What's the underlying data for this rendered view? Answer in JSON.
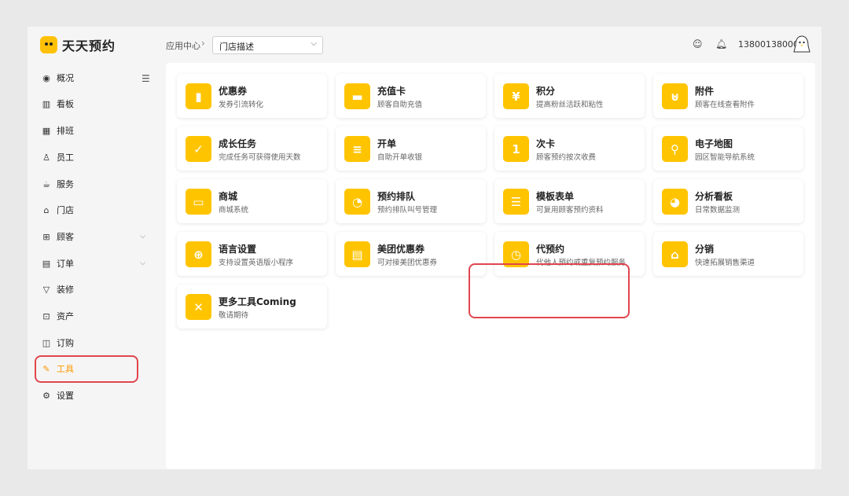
{
  "brand": {
    "name": "天天预约"
  },
  "header": {
    "breadcrumb": "应用中心",
    "separator": "›",
    "store_select": {
      "value": "门店描述"
    },
    "phone": "13800138000"
  },
  "sidebar": {
    "items": [
      {
        "label": "概况",
        "icon": "dashboard-icon",
        "glyph": "◉"
      },
      {
        "label": "看板",
        "icon": "bar-chart-icon",
        "glyph": "▥"
      },
      {
        "label": "排班",
        "icon": "calendar-icon",
        "glyph": "▦"
      },
      {
        "label": "员工",
        "icon": "user-icon",
        "glyph": "♙"
      },
      {
        "label": "服务",
        "icon": "cup-icon",
        "glyph": "☕"
      },
      {
        "label": "门店",
        "icon": "store-icon",
        "glyph": "⌂"
      },
      {
        "label": "顾客",
        "icon": "customers-icon",
        "glyph": "⊞"
      },
      {
        "label": "订单",
        "icon": "order-icon",
        "glyph": "▤"
      },
      {
        "label": "装修",
        "icon": "shirt-icon",
        "glyph": "▽"
      },
      {
        "label": "资产",
        "icon": "asset-icon",
        "glyph": "⊡"
      },
      {
        "label": "订购",
        "icon": "bag-icon",
        "glyph": "◫"
      },
      {
        "label": "工具",
        "icon": "tool-icon",
        "glyph": "✎",
        "active": true
      },
      {
        "label": "设置",
        "icon": "gear-icon",
        "glyph": "⚙"
      }
    ]
  },
  "tools": [
    {
      "name": "优惠券",
      "desc": "发券引流转化",
      "icon": "coupon-icon",
      "glyph": "▮"
    },
    {
      "name": "充值卡",
      "desc": "顾客自助充值",
      "icon": "card-icon",
      "glyph": "▬"
    },
    {
      "name": "积分",
      "desc": "提高粉丝活跃和粘性",
      "icon": "points-icon",
      "glyph": "¥"
    },
    {
      "name": "附件",
      "desc": "顾客在线查看附件",
      "icon": "attachment-icon",
      "glyph": "⊍"
    },
    {
      "name": "成长任务",
      "desc": "完成任务可获得使用天数",
      "icon": "task-icon",
      "glyph": "✓"
    },
    {
      "name": "开单",
      "desc": "自助开单收银",
      "icon": "invoice-icon",
      "glyph": "≡"
    },
    {
      "name": "次卡",
      "desc": "顾客预约按次收费",
      "icon": "count-card-icon",
      "glyph": "1"
    },
    {
      "name": "电子地图",
      "desc": "园区智能导航系统",
      "icon": "map-icon",
      "glyph": "⚲"
    },
    {
      "name": "商城",
      "desc": "商城系统",
      "icon": "mall-icon",
      "glyph": "▭"
    },
    {
      "name": "预约排队",
      "desc": "预约排队叫号管理",
      "icon": "queue-clock-icon",
      "glyph": "◔"
    },
    {
      "name": "模板表单",
      "desc": "可复用顾客预约资料",
      "icon": "form-icon",
      "glyph": "☰"
    },
    {
      "name": "分析看板",
      "desc": "日常数据监测",
      "icon": "pie-chart-icon",
      "glyph": "◕"
    },
    {
      "name": "语言设置",
      "desc": "支持设置英语版小程序",
      "icon": "globe-icon",
      "glyph": "⊕"
    },
    {
      "name": "美团优惠券",
      "desc": "可对接美团优惠券",
      "icon": "ticket-icon",
      "glyph": "▤"
    },
    {
      "name": "代预约",
      "desc": "代他人预约或重复预约服务",
      "icon": "clock-icon",
      "glyph": "◷"
    },
    {
      "name": "分销",
      "desc": "快速拓展销售渠道",
      "icon": "distribution-icon",
      "glyph": "⌂"
    },
    {
      "name": "更多工具Coming",
      "desc": "敬请期待",
      "icon": "wrench-icon",
      "glyph": "✕"
    }
  ]
}
